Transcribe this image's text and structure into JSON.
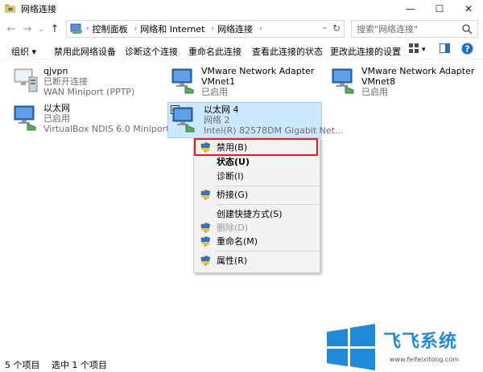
{
  "window": {
    "title": "网络连接",
    "minimize": "—",
    "maximize": "☐",
    "close": "✕"
  },
  "nav": {
    "back": "←",
    "forward": "→",
    "recent": "⌄",
    "up": "↑"
  },
  "address": {
    "crumbs": [
      "控制面板",
      "网络和 Internet",
      "网络连接"
    ],
    "refresh": "↻"
  },
  "search": {
    "placeholder": "搜索\"网络连接\""
  },
  "toolbar": {
    "organize": "组织 ▾",
    "disable_device": "禁用此网络设备",
    "diagnose": "诊断这个连接",
    "rename": "重命名此连接",
    "view_status": "查看此连接的状态",
    "change_settings": "更改此连接的设置",
    "help": "?"
  },
  "items": [
    {
      "name": "qjvpn",
      "line2": "已断开连接",
      "line3": "WAN Miniport (PPTP)"
    },
    {
      "name": "VMware Network Adapter",
      "line2": "VMnet1",
      "line3": "已启用"
    },
    {
      "name": "VMware Network Adapter",
      "line2": "VMnet8",
      "line3": "已启用"
    },
    {
      "name": "以太网",
      "line2": "已启用",
      "line3": "VirtualBox NDIS 6.0 Miniport ..."
    },
    {
      "name": "以太网 4",
      "line2": "网络  2",
      "line3": "Intel(R) 82578DM Gigabit Net..."
    }
  ],
  "context_menu": {
    "disable": "禁用(B)",
    "status": "状态(U)",
    "diagnose": "诊断(I)",
    "bridge": "桥接(G)",
    "create_shortcut": "创建快捷方式(S)",
    "delete": "删除(D)",
    "rename": "重命名(M)",
    "properties": "属性(R)"
  },
  "status": {
    "count": "5 个项目",
    "selected": "选中 1 个项目"
  },
  "watermark": {
    "brand": "飞飞系统",
    "url": "www.feifeixitong.com"
  },
  "colors": {
    "accent": "#1f8ad8",
    "selection": "#cce8ff",
    "highlight_box": "#e02020"
  }
}
